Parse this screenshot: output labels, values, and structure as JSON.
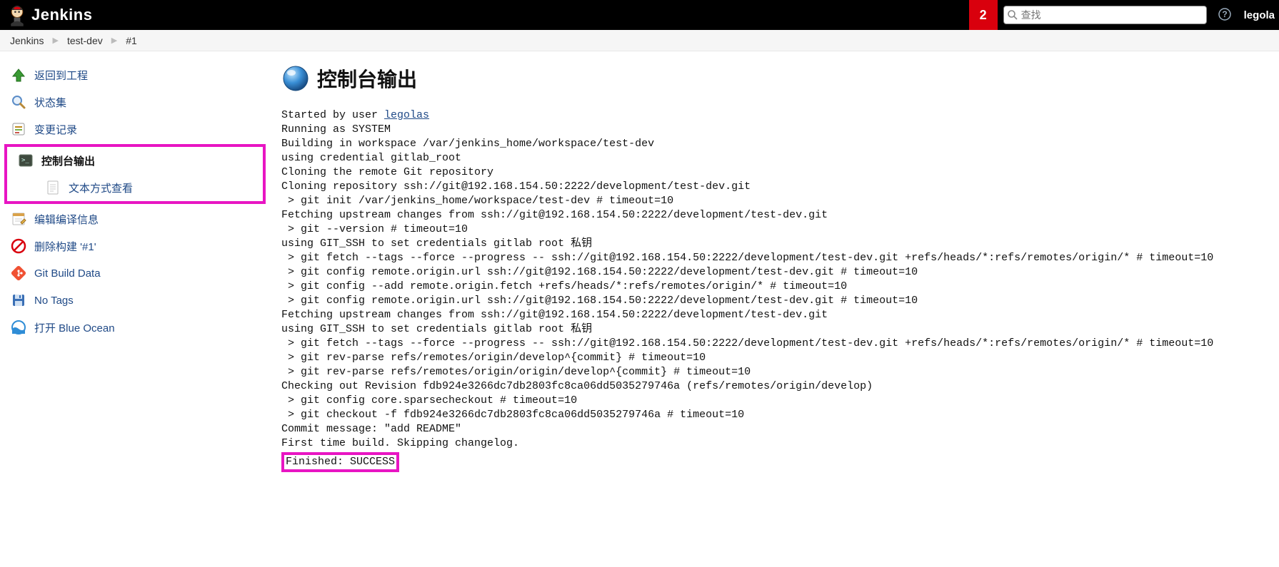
{
  "header": {
    "title": "Jenkins",
    "badge": "2",
    "search_placeholder": "查找",
    "user": "legola"
  },
  "breadcrumbs": {
    "items": [
      "Jenkins",
      "test-dev",
      "#1"
    ]
  },
  "sidebar": {
    "back": "返回到工程",
    "status": "状态集",
    "changes": "变更记录",
    "console": "控制台输出",
    "console_plain": "文本方式查看",
    "editbuild": "编辑编译信息",
    "delete": "删除构建 '#1'",
    "gitdata": "Git Build Data",
    "notags": "No Tags",
    "blueocean": "打开 Blue Ocean"
  },
  "main": {
    "heading": "控制台输出",
    "started_prefix": "Started by user ",
    "started_user": "legolas",
    "lines_pre": "Running as SYSTEM\nBuilding in workspace /var/jenkins_home/workspace/test-dev\nusing credential gitlab_root\nCloning the remote Git repository\nCloning repository ssh://git@192.168.154.50:2222/development/test-dev.git\n > git init /var/jenkins_home/workspace/test-dev # timeout=10\nFetching upstream changes from ssh://git@192.168.154.50:2222/development/test-dev.git\n > git --version # timeout=10\nusing GIT_SSH to set credentials gitlab root 私钥\n > git fetch --tags --force --progress -- ssh://git@192.168.154.50:2222/development/test-dev.git +refs/heads/*:refs/remotes/origin/* # timeout=10\n > git config remote.origin.url ssh://git@192.168.154.50:2222/development/test-dev.git # timeout=10\n > git config --add remote.origin.fetch +refs/heads/*:refs/remotes/origin/* # timeout=10\n > git config remote.origin.url ssh://git@192.168.154.50:2222/development/test-dev.git # timeout=10\nFetching upstream changes from ssh://git@192.168.154.50:2222/development/test-dev.git\nusing GIT_SSH to set credentials gitlab root 私钥\n > git fetch --tags --force --progress -- ssh://git@192.168.154.50:2222/development/test-dev.git +refs/heads/*:refs/remotes/origin/* # timeout=10\n > git rev-parse refs/remotes/origin/develop^{commit} # timeout=10\n > git rev-parse refs/remotes/origin/origin/develop^{commit} # timeout=10\nChecking out Revision fdb924e3266dc7db2803fc8ca06dd5035279746a (refs/remotes/origin/develop)\n > git config core.sparsecheckout # timeout=10\n > git checkout -f fdb924e3266dc7db2803fc8ca06dd5035279746a # timeout=10\nCommit message: \"add README\"\nFirst time build. Skipping changelog.",
    "finished": "Finished: SUCCESS"
  }
}
